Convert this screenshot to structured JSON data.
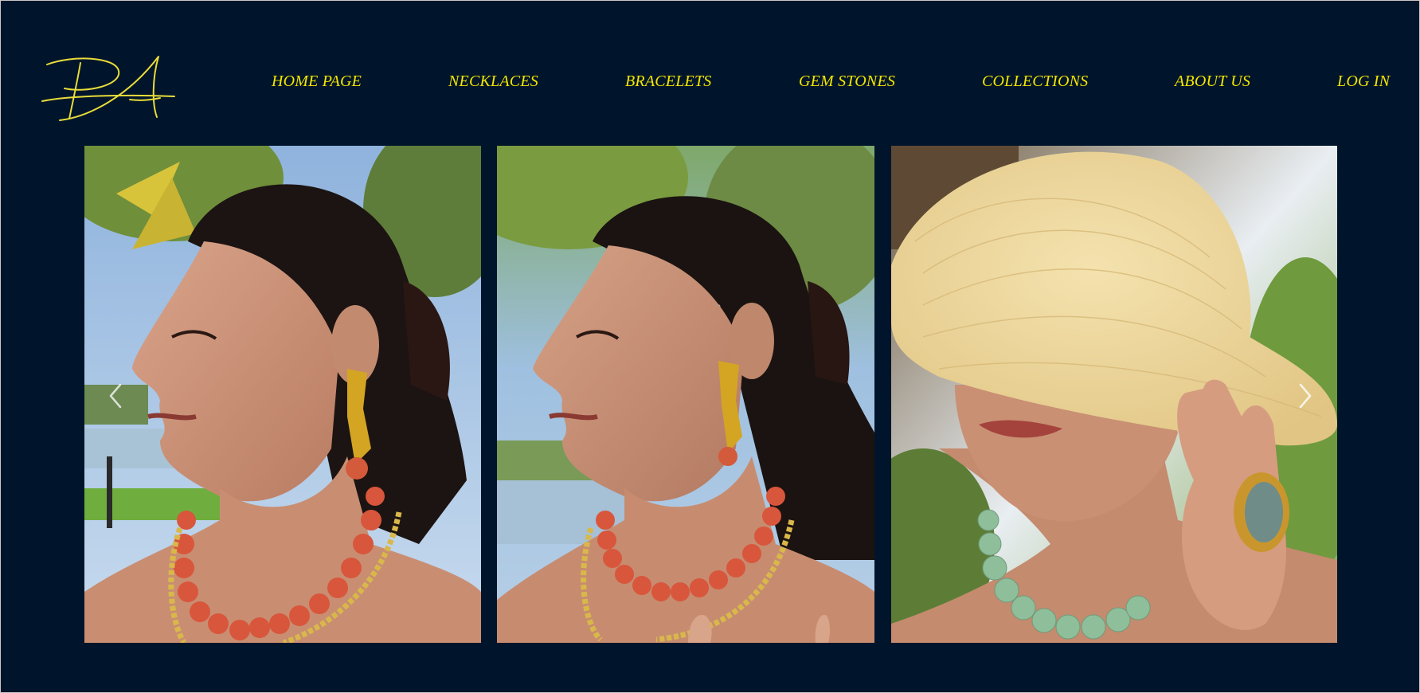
{
  "colors": {
    "background": "#00152b",
    "nav_text": "#f2e600",
    "logo": "#e8dc3a"
  },
  "logo": {
    "icon": "monogram-logo-icon"
  },
  "nav": {
    "items": [
      {
        "label": "HOME PAGE"
      },
      {
        "label": "NECKLACES"
      },
      {
        "label": "BRACELETS"
      },
      {
        "label": "GEM STONES"
      },
      {
        "label": "COLLECTIONS"
      },
      {
        "label": "ABOUT US"
      },
      {
        "label": "LOG IN"
      }
    ]
  },
  "carousel": {
    "prev_icon": "chevron-left-icon",
    "next_icon": "chevron-right-icon",
    "slides": [
      {
        "subject": "woman-profile-coral-necklace"
      },
      {
        "subject": "woman-profile-coral-necklace-closeup"
      },
      {
        "subject": "woman-straw-hat-green-stone-necklace"
      }
    ]
  }
}
